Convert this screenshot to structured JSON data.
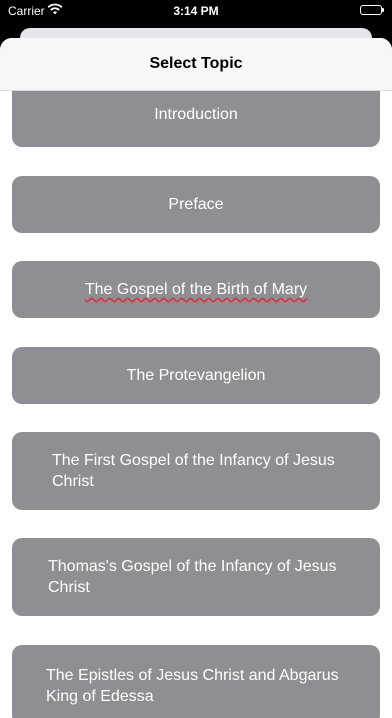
{
  "status_bar": {
    "carrier": "Carrier",
    "time": "3:14 PM"
  },
  "nav": {
    "title": "Select Topic"
  },
  "topics": [
    {
      "label": "Introduction"
    },
    {
      "label": "Preface"
    },
    {
      "label": "The Gospel of the Birth of Mary"
    },
    {
      "label": "The Protevangelion"
    },
    {
      "label": "The First Gospel of the Infancy of Jesus Christ"
    },
    {
      "label": "Thomas's Gospel of the Infancy of Jesus Christ"
    },
    {
      "label": "The Epistles of Jesus Christ and Abgarus King of Edessa"
    }
  ],
  "colors": {
    "button_bg": "#8e8e93",
    "button_text": "#ffffff",
    "spell_underline": "#e0303a"
  }
}
